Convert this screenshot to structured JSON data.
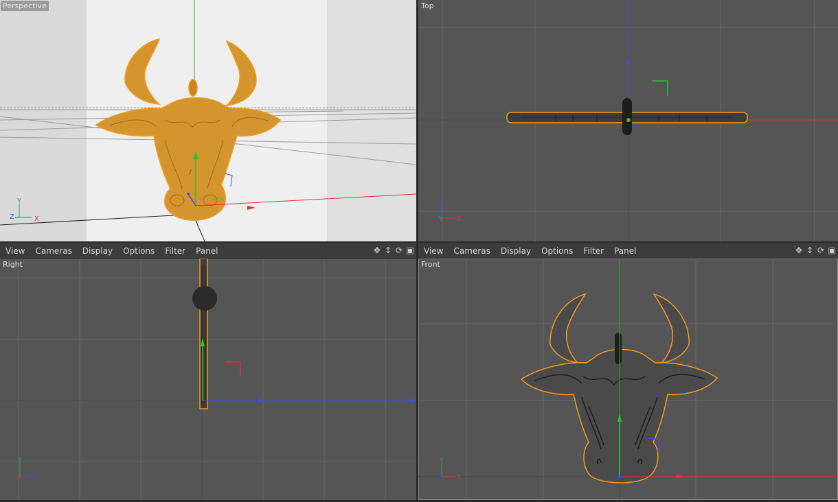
{
  "viewports": {
    "perspective": {
      "label": "Perspective"
    },
    "top": {
      "label": "Top"
    },
    "right": {
      "label": "Right"
    },
    "front": {
      "label": "Front"
    }
  },
  "menu": {
    "items": [
      "View",
      "Cameras",
      "Display",
      "Options",
      "Filter",
      "Panel"
    ]
  },
  "axis_letters": {
    "x": "X",
    "y": "Y",
    "z": "Z"
  },
  "colors": {
    "selection": "#f39c1d",
    "gold": "#d4952e",
    "axis_x": "#d93434",
    "axis_y": "#3fbf3f",
    "axis_z": "#3b4fe0",
    "viewport_bg": "#555555",
    "grid": "#6a6a6a"
  },
  "icons": [
    "move-view-icon",
    "pan-icon",
    "rotate-icon",
    "maximize-icon"
  ]
}
